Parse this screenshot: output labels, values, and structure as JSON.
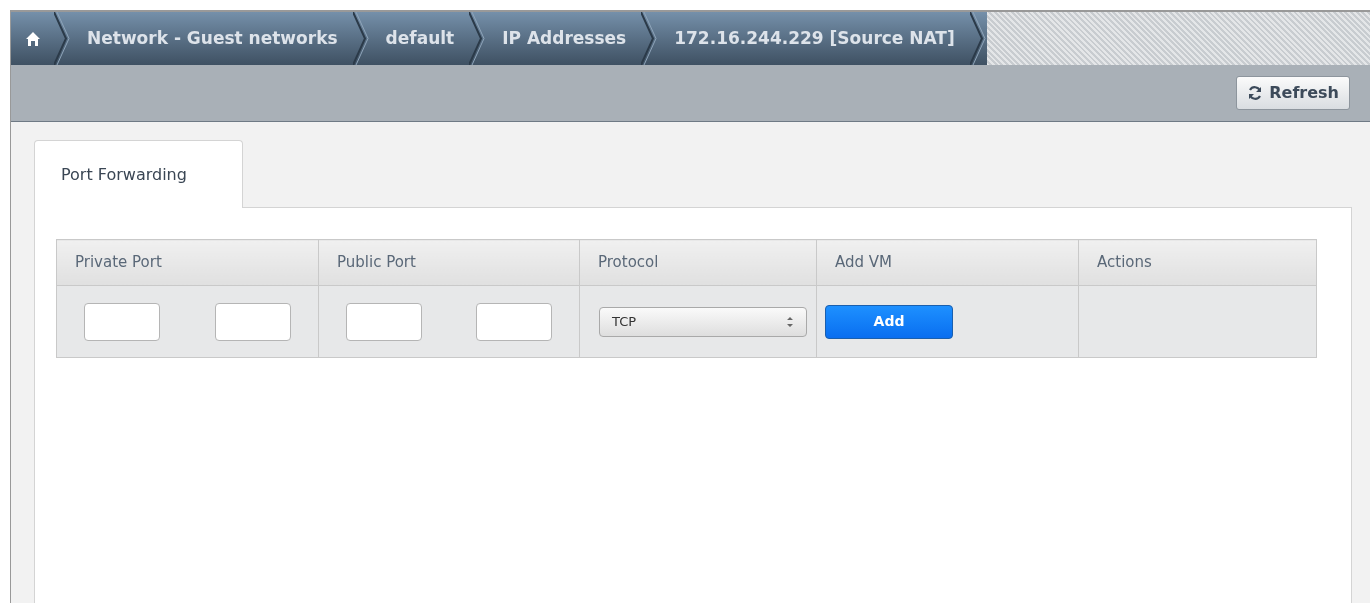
{
  "breadcrumbs": [
    {
      "kind": "home"
    },
    {
      "kind": "text",
      "label": "Network - Guest networks"
    },
    {
      "kind": "text",
      "label": "default"
    },
    {
      "kind": "text",
      "label": "IP Addresses"
    },
    {
      "kind": "text",
      "label": "172.16.244.229 [Source NAT]"
    }
  ],
  "toolbar": {
    "refresh_button": "Refresh"
  },
  "tabs": [
    {
      "label": "Port Forwarding",
      "selected": true
    }
  ],
  "table": {
    "columns": [
      "Private Port",
      "Public Port",
      "Protocol",
      "Add VM",
      "Actions"
    ],
    "rows": [
      {
        "cells": [
          {
            "kind": "range"
          },
          {
            "kind": "range"
          },
          {
            "kind": "select",
            "value": "TCP"
          },
          {
            "kind": "button",
            "label": "Add"
          },
          {
            "kind": "empty"
          }
        ]
      }
    ]
  }
}
